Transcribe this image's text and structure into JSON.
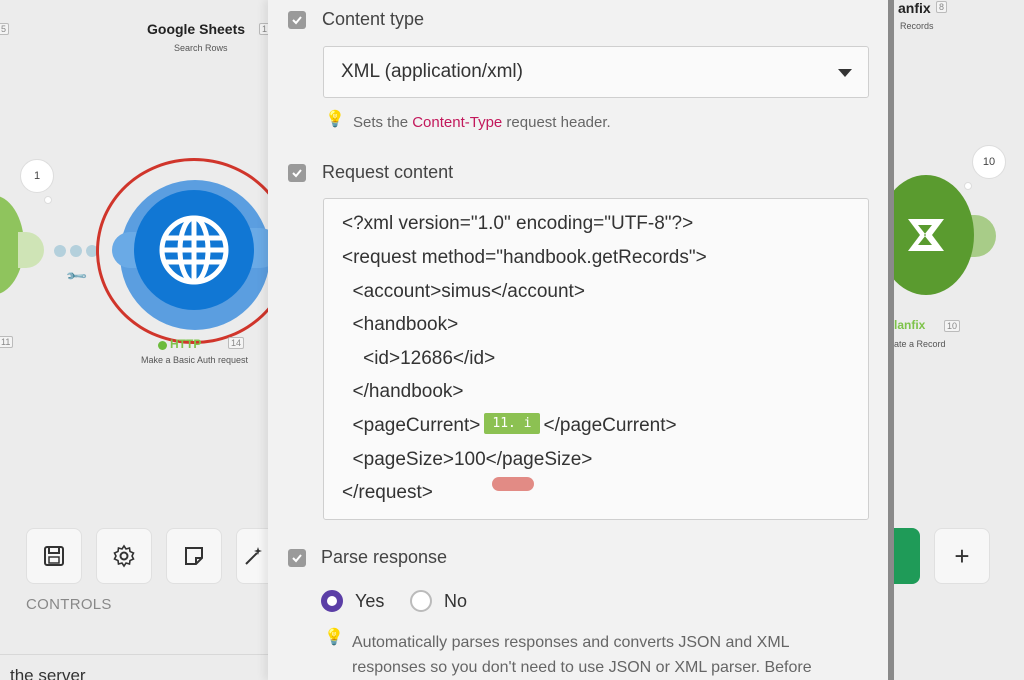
{
  "canvas": {
    "google_sheets": {
      "title": "Google Sheets",
      "subtitle": "Search Rows",
      "id": "5"
    },
    "left_node": {
      "id": "11"
    },
    "bubble_left": "1",
    "http": {
      "title": "HTTP",
      "id": "14",
      "subtitle": "Make a Basic Auth request"
    },
    "right_top": {
      "title": "anfix",
      "id": "8",
      "subtitle": "Records"
    },
    "right_node": {
      "title": "lanfix",
      "id": "10",
      "subtitle": "ate a Record"
    },
    "bubble_right": "10",
    "controls_label": "CONTROLS",
    "bottom_text": "the server"
  },
  "panel": {
    "content_type": {
      "label": "Content type",
      "value": "XML (application/xml)",
      "hint_prefix": "Sets the ",
      "hint_link": "Content-Type",
      "hint_suffix": " request header."
    },
    "request_content": {
      "label": "Request content",
      "lines": [
        "<?xml version=\"1.0\" encoding=\"UTF-8\"?>",
        "<request method=\"handbook.getRecords\">",
        "  <account>simus</account>",
        "  <handbook>",
        "    <id>12686</id>",
        "  </handbook>",
        "  <pageCurrent>",
        "  <pageSize>100</pageSize>",
        "</request>"
      ],
      "page_current_close": "</pageCurrent>",
      "token": "11. i"
    },
    "parse_response": {
      "label": "Parse response",
      "options": [
        "Yes",
        "No"
      ],
      "selected": "Yes",
      "hint_line1": "Automatically parses responses and converts JSON and XML",
      "hint_line2": "responses so you don't need to use JSON or XML parser. Before"
    }
  },
  "colors": {
    "accent": "#5b3ea6",
    "http_blue": "#1177d4",
    "highlight": "#d0352b",
    "token_green": "#8cc152"
  }
}
